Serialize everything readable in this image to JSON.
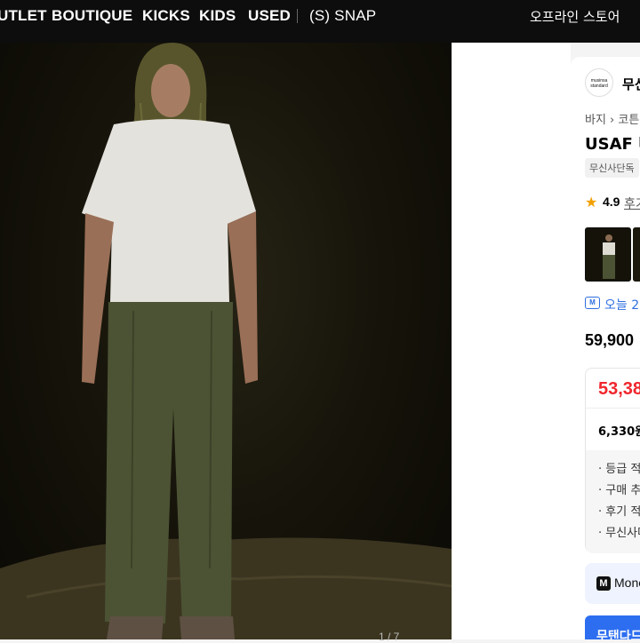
{
  "nav": {
    "items": [
      "UTLET",
      "BOUTIQUE",
      "KICKS",
      "KIDS",
      "USED"
    ],
    "snap": "(S) SNAP",
    "offline_store": "오프라인 스토어"
  },
  "gallery": {
    "counter": "1 / 7"
  },
  "product": {
    "brand_logo": "musinsa standard",
    "brand_name": "무신",
    "breadcrumb": "바지 › 코튼",
    "title": "USAF 미",
    "badge": "무신사단독",
    "rating": "4.9",
    "reviews_label": "후기",
    "delivery": "오늘 22",
    "original_price": "59,900",
    "sale_price": "53,38",
    "points": "6,330원",
    "details": [
      "· 등급 적",
      "· 구매 추",
      "· 후기 적",
      "· 무신사머"
    ],
    "pay_label": "Mone",
    "buy_label": "무탠다드"
  },
  "colors": {
    "accent_blue": "#2d6ef0",
    "sale_red": "#f0262d",
    "rating_star": "#f2a000"
  }
}
